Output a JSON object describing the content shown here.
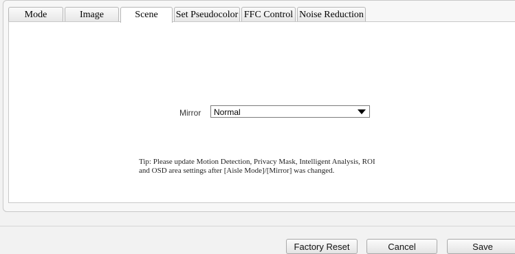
{
  "tabs": [
    {
      "label": "Mode",
      "active": false
    },
    {
      "label": "Image",
      "active": false
    },
    {
      "label": "Scene",
      "active": true
    },
    {
      "label": "Set Pseudocolor",
      "active": false
    },
    {
      "label": "FFC Control",
      "active": false
    },
    {
      "label": "Noise Reduction",
      "active": false
    }
  ],
  "mirror": {
    "label": "Mirror",
    "value": "Normal"
  },
  "tip": "Tip: Please update Motion Detection, Privacy Mask, Intelligent Analysis, ROI and OSD area settings after [Aisle Mode]/[Mirror] was changed.",
  "buttons": {
    "factory_reset": "Factory Reset",
    "cancel": "Cancel",
    "save": "Save"
  }
}
